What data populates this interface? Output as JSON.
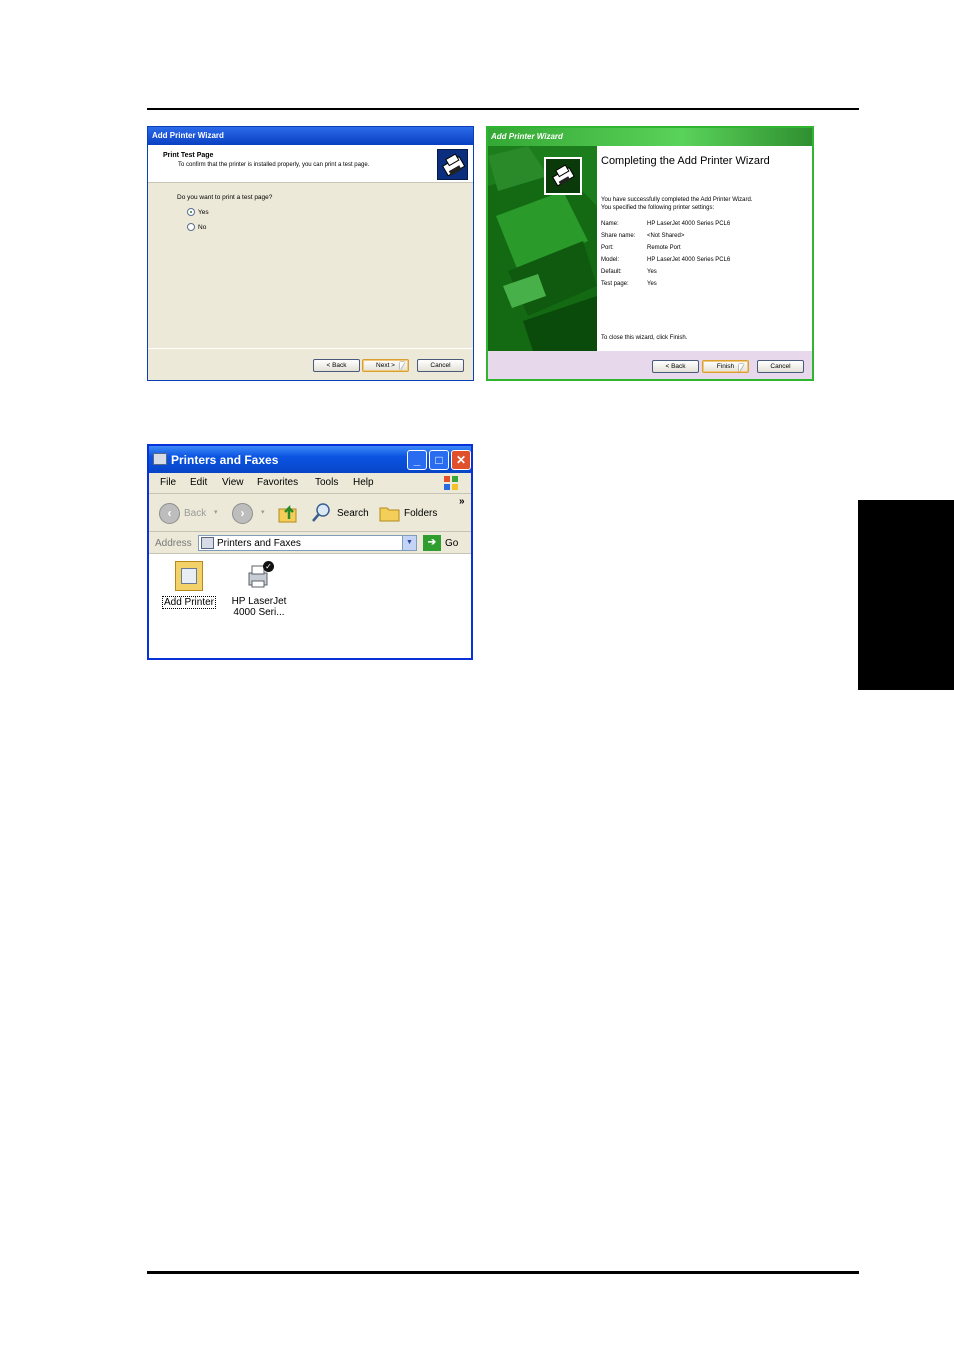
{
  "wizard1": {
    "title": "Add Printer Wizard",
    "header_title": "Print Test Page",
    "header_desc": "To confirm that the printer is installed properly, you can print a test page.",
    "question": "Do you want to print a test page?",
    "options": [
      {
        "label": "Yes",
        "selected": true
      },
      {
        "label": "No",
        "selected": false
      }
    ],
    "buttons": {
      "back": "< Back",
      "next": "Next >",
      "cancel": "Cancel"
    }
  },
  "wizard2": {
    "title": "Add Printer Wizard",
    "heading": "Completing the Add Printer Wizard",
    "intro1": "You have successfully completed the Add Printer Wizard.",
    "intro2": "You specified the following printer settings:",
    "settings": [
      {
        "label": "Name:",
        "value": "HP LaserJet 4000 Series PCL6"
      },
      {
        "label": "Share name:",
        "value": "<Not Shared>"
      },
      {
        "label": "Port:",
        "value": "Remote Port"
      },
      {
        "label": "Model:",
        "value": "HP LaserJet 4000 Series PCL6"
      },
      {
        "label": "Default:",
        "value": "Yes"
      },
      {
        "label": "Test page:",
        "value": "Yes"
      }
    ],
    "close_note": "To close this wizard, click Finish.",
    "buttons": {
      "back": "< Back",
      "finish": "Finish",
      "cancel": "Cancel"
    },
    "accent": "#2fb52f"
  },
  "explorer": {
    "title": "Printers and Faxes",
    "menu": [
      "File",
      "Edit",
      "View",
      "Favorites",
      "Tools",
      "Help"
    ],
    "toolbar": {
      "back": "Back",
      "search": "Search",
      "folders": "Folders",
      "more": "»"
    },
    "address": {
      "label": "Address",
      "value": "Printers and Faxes",
      "go": "Go"
    },
    "items": [
      {
        "line1": "Add Printer",
        "line2": ""
      },
      {
        "line1": "HP LaserJet",
        "line2": "4000 Seri..."
      }
    ],
    "icons": [
      "printer-icon",
      "add-printer-icon",
      "default-check-icon",
      "windows-logo-icon"
    ],
    "accent": "#0a54e2"
  }
}
